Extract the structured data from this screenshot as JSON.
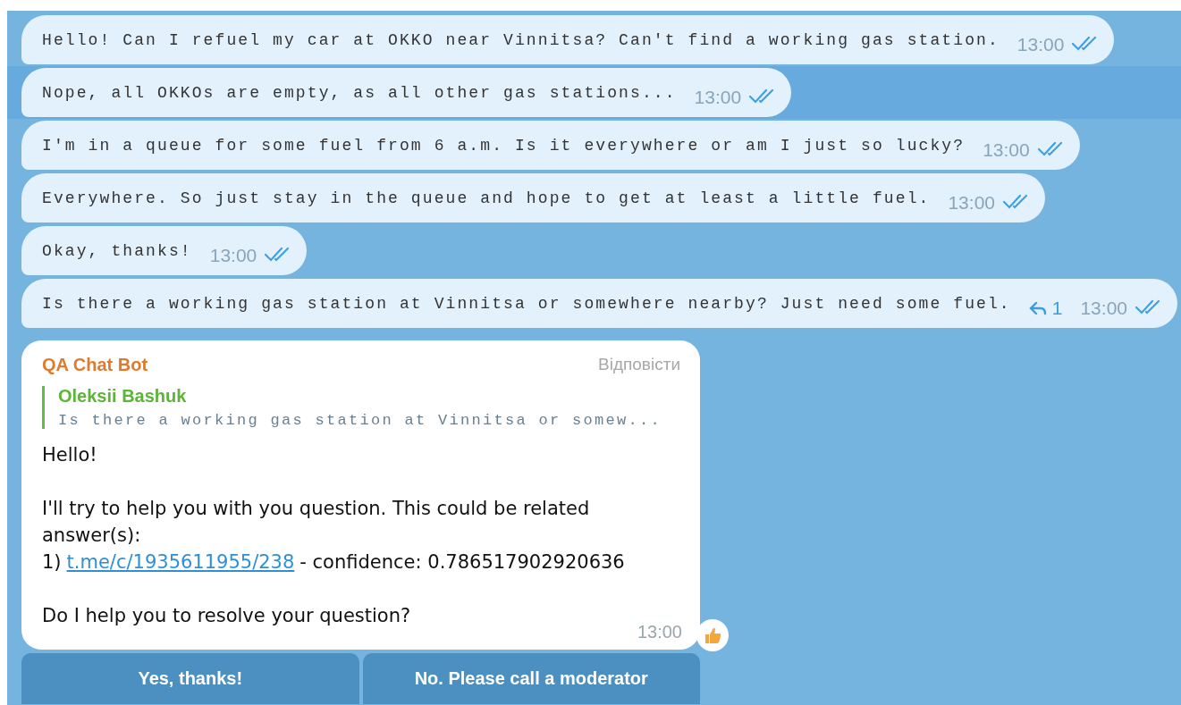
{
  "messages": [
    {
      "text": "Hello! Can I refuel my car at OKKO near Vinnitsa? Can't find a working gas station.",
      "time": "13:00",
      "read": true,
      "selected": false
    },
    {
      "text": "Nope, all OKKOs are empty, as all other gas stations...",
      "time": "13:00",
      "read": true,
      "selected": true
    },
    {
      "text": "I'm in a queue for some fuel from 6 a.m. Is it everywhere or am I just so lucky?",
      "time": "13:00",
      "read": true,
      "selected": false
    },
    {
      "text": "Everywhere. So just stay in the queue and hope to get at least a little fuel.",
      "time": "13:00",
      "read": true,
      "selected": false
    },
    {
      "text": "Okay, thanks!",
      "time": "13:00",
      "read": true,
      "selected": false
    },
    {
      "text": "Is there a working gas station at Vinnitsa or somewhere nearby? Just need some fuel.",
      "replies": "1",
      "time": "13:00",
      "read": true,
      "selected": false
    }
  ],
  "bot_message": {
    "sender": "QA Chat Bot",
    "reply_action": "Відповісти",
    "quote": {
      "author": "Oleksii Bashuk",
      "text": "Is there a working gas station at Vinnitsa or somew..."
    },
    "paragraphs": [
      [
        {
          "text": "Hello!"
        }
      ],
      [
        {
          "text": "I'll try to help you with you question. This could be related"
        },
        {
          "text": "answer(s):"
        },
        {
          "prefix": "1)",
          "link": "t.me/c/1935611955/238",
          "text": "- confidence: 0.786517902920636"
        }
      ],
      [
        {
          "text": "Do I help you to resolve your question?"
        }
      ]
    ],
    "time": "13:00",
    "reaction": {
      "kind": "thumbs_up"
    }
  },
  "buttons": [
    "Yes, thanks!",
    "No. Please call a moderator"
  ]
}
